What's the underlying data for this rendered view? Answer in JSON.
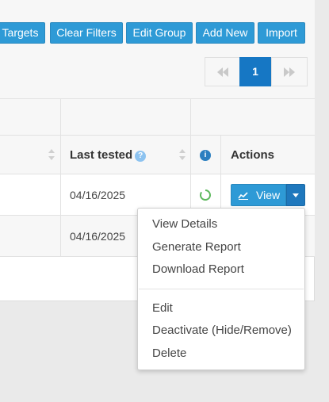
{
  "toolbar": {
    "buttons": [
      {
        "label": "Targets"
      },
      {
        "label": "Clear Filters"
      },
      {
        "label": "Edit Group"
      },
      {
        "label": "Add New"
      },
      {
        "label": "Import"
      }
    ]
  },
  "pagination": {
    "current_page": "1"
  },
  "table": {
    "columns": {
      "last_tested": "Last tested",
      "help_glyph": "?",
      "info_glyph": "i",
      "actions": "Actions"
    },
    "rows": [
      {
        "last_tested": "04/16/2025",
        "status": "loading"
      },
      {
        "last_tested": "04/16/2025",
        "status": ""
      }
    ],
    "view_button_label": "View"
  },
  "dropdown": {
    "items": [
      {
        "label": "View Details"
      },
      {
        "label": "Generate Report"
      },
      {
        "label": "Download Report"
      },
      {
        "label": "Edit"
      },
      {
        "label": "Deactivate (Hide/Remove)"
      },
      {
        "label": "Delete"
      }
    ]
  },
  "colors": {
    "primary": "#2e9ad6",
    "primary_dark": "#1f78bd",
    "status_green": "#5cb85c"
  }
}
